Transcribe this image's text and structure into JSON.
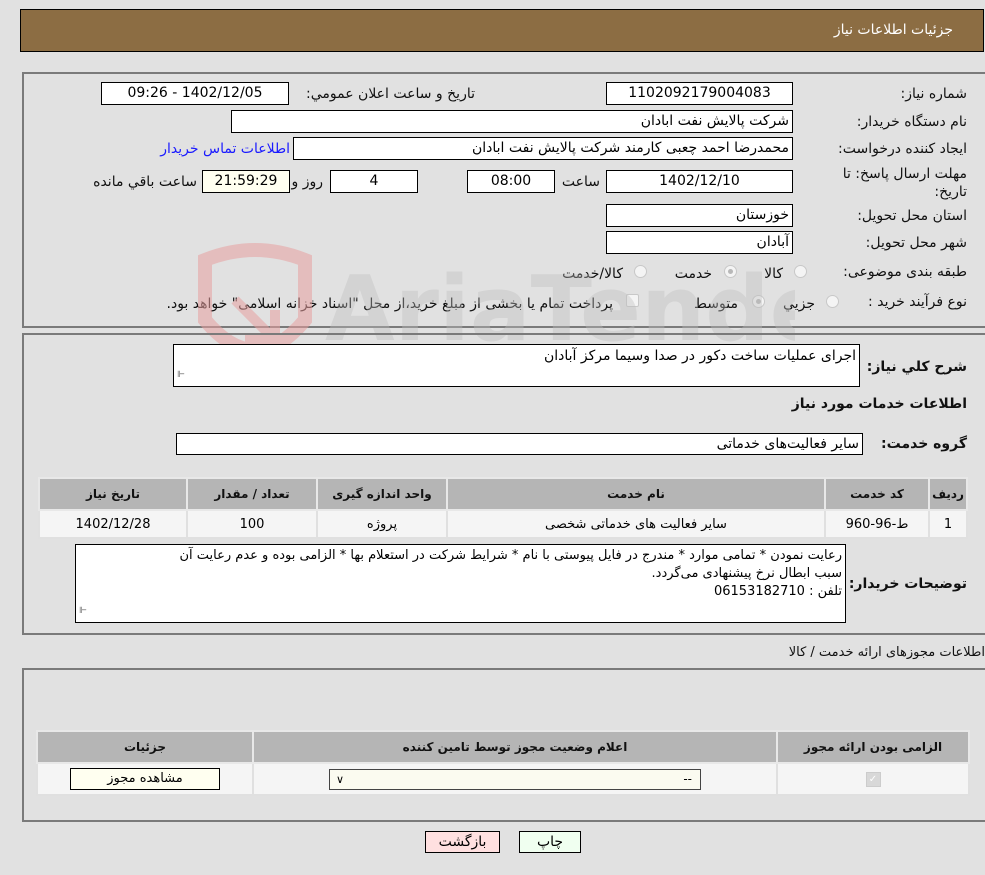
{
  "header": {
    "title": "جزئیات اطلاعات نیاز"
  },
  "form": {
    "need_number_label": "شماره نیاز:",
    "need_number": "1102092179004083",
    "announce_label": "تاریخ و ساعت اعلان عمومي:",
    "announce_value": "1402/12/05 - 09:26",
    "buyer_org_label": "نام دستگاه خريدار:",
    "buyer_org": "شرکت پالایش نفت ابادان",
    "creator_label": "ایجاد کننده درخواست:",
    "creator": "محمدرضا احمد چعبی کارمند شرکت پالایش نفت ابادان",
    "contact_link": "اطلاعات تماس خریدار",
    "deadline_label_1": "مهلت ارسال پاسخ: تا",
    "deadline_label_2": "تاریخ:",
    "deadline_date": "1402/12/10",
    "time_label": "ساعت",
    "deadline_time": "08:00",
    "days": "4",
    "days_label": "روز و",
    "remaining": "21:59:29",
    "remaining_label": "ساعت باقي مانده",
    "province_label": "استان محل تحویل:",
    "province": "خوزستان",
    "city_label": "شهر محل تحویل:",
    "city": "آبادان",
    "category_label": "طبقه بندی موضوعی:",
    "category_options": [
      {
        "label": "کالا",
        "checked": false
      },
      {
        "label": "خدمت",
        "checked": true
      },
      {
        "label": "کالا/خدمت",
        "checked": false
      }
    ],
    "process_label": "نوع فرآیند خرید :",
    "process_options": [
      {
        "label": "جزيي",
        "checked": false
      },
      {
        "label": "متوسط",
        "checked": true
      }
    ],
    "treasury_note": "پرداخت تمام یا بخشی از مبلغ خرید،از محل \"اسناد خزانه اسلامی\" خواهد بود."
  },
  "description": {
    "label": "شرح کلي نياز:",
    "value": "اجرای عملیات ساخت دکور در صدا وسیما مرکز آبادان",
    "services_title": "اطلاعات خدمات مورد نیاز",
    "group_label": "گروه خدمت:",
    "group_value": "سایر فعالیت‌های خدماتی"
  },
  "services_table": {
    "headers": [
      "ردیف",
      "کد خدمت",
      "نام خدمت",
      "واحد اندازه گیری",
      "تعداد / مقدار",
      "تاریخ نیاز"
    ],
    "rows": [
      [
        "1",
        "ط-96-960",
        "سایر فعالیت های خدماتی شخصی",
        "پروژه",
        "100",
        "1402/12/28"
      ]
    ]
  },
  "buyer_notes": {
    "label": "توضیحات خریدار:",
    "line1": "رعایت نمودن * تمامی موارد * مندرج در فایل پیوستی با نام * شرایط شرکت در استعلام بها * الزامی بوده و عدم رعایت آن",
    "line2": "سبب ابطال نرخ پیشنهادی می‌گردد.",
    "line3": "تلفن : 06153182710"
  },
  "permits": {
    "title": "اطلاعات مجوزهای ارائه خدمت / کالا",
    "headers": [
      "الزامی بودن ارائه مجوز",
      "اعلام وضعیت مجوز توسط تامین کننده",
      "جزئیات"
    ],
    "select_value": "--",
    "view_button": "مشاهده مجوز"
  },
  "buttons": {
    "print": "چاپ",
    "back": "بازگشت"
  },
  "watermark": {
    "text": "AriaTender.neT"
  }
}
